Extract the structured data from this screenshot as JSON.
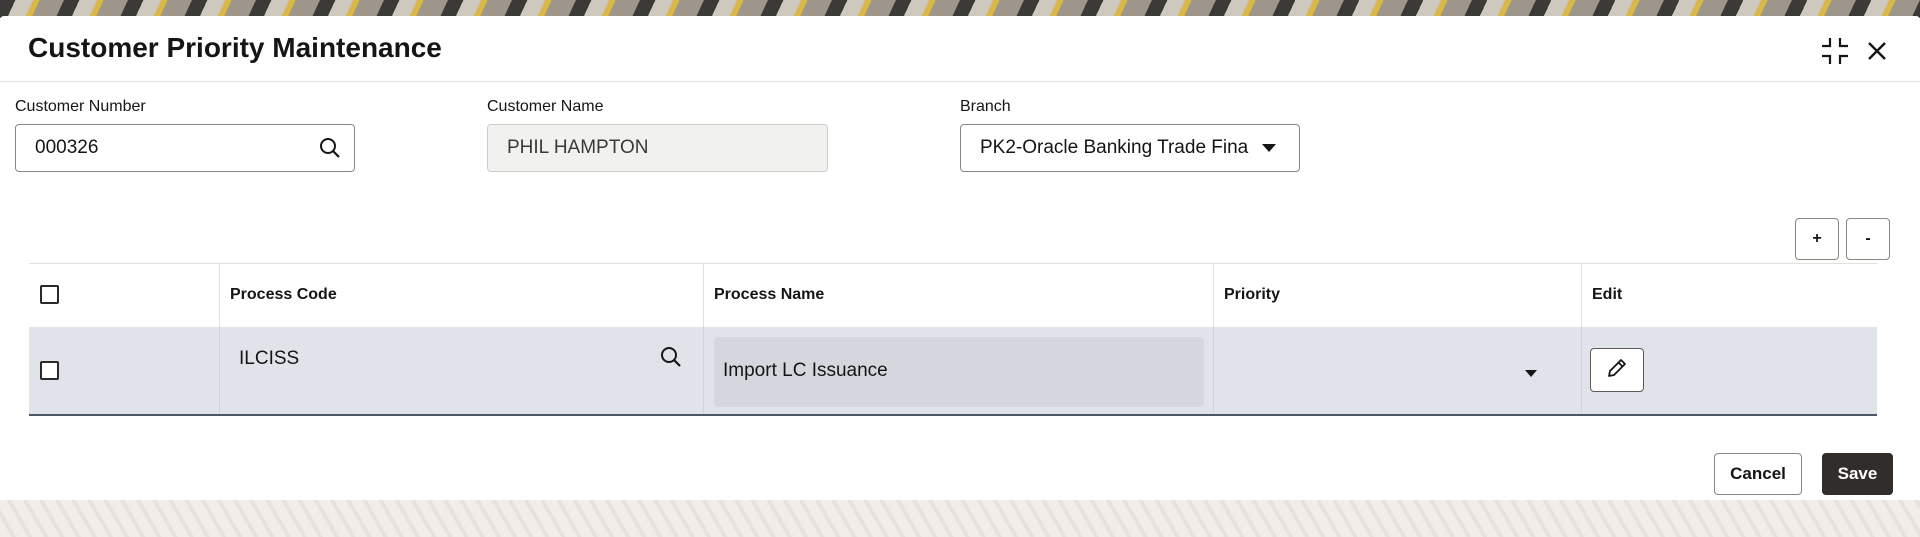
{
  "dialog": {
    "title": "Customer Priority Maintenance"
  },
  "form": {
    "customer_number": {
      "label": "Customer Number",
      "value": "000326"
    },
    "customer_name": {
      "label": "Customer Name",
      "value": "PHIL HAMPTON"
    },
    "branch": {
      "label": "Branch",
      "value": "PK2-Oracle Banking Trade Fina"
    }
  },
  "grid_controls": {
    "add_label": "+",
    "remove_label": "-"
  },
  "grid": {
    "headers": [
      "Process Code",
      "Process Name",
      "Priority",
      "Edit"
    ],
    "rows": [
      {
        "process_code": "ILCISS",
        "process_name": "Import LC Issuance",
        "priority": ""
      }
    ]
  },
  "footer": {
    "cancel_label": "Cancel",
    "save_label": "Save"
  },
  "icons": {
    "search": "search-icon",
    "collapse": "collapse-icon",
    "close": "close-icon",
    "dropdown": "caret-down-icon",
    "edit": "pencil-icon"
  }
}
